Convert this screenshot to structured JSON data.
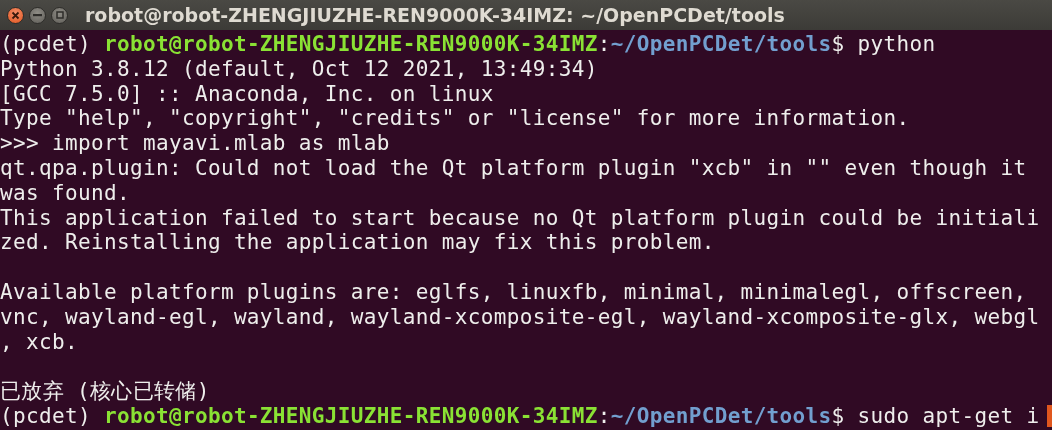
{
  "window": {
    "title": "robot@robot-ZHENGJIUZHE-REN9000K-34IMZ: ~/OpenPCDet/tools"
  },
  "terminal": {
    "lines": [
      {
        "kind": "prompt",
        "env": "(pcdet) ",
        "user_host": "robot@robot-ZHENGJIUZHE-REN9000K-34IMZ",
        "separator": ":",
        "path": "~/OpenPCDet/tools",
        "symbol": "$ ",
        "command": "python",
        "cursor": false
      },
      {
        "kind": "output",
        "text": "Python 3.8.12 (default, Oct 12 2021, 13:49:34)"
      },
      {
        "kind": "output",
        "text": "[GCC 7.5.0] :: Anaconda, Inc. on linux"
      },
      {
        "kind": "output",
        "text": "Type \"help\", \"copyright\", \"credits\" or \"license\" for more information."
      },
      {
        "kind": "output",
        "text": ">>> import mayavi.mlab as mlab"
      },
      {
        "kind": "output",
        "text": "qt.qpa.plugin: Could not load the Qt platform plugin \"xcb\" in \"\" even though it"
      },
      {
        "kind": "output",
        "text": "was found."
      },
      {
        "kind": "output",
        "text": "This application failed to start because no Qt platform plugin could be initiali"
      },
      {
        "kind": "output",
        "text": "zed. Reinstalling the application may fix this problem."
      },
      {
        "kind": "blank"
      },
      {
        "kind": "output",
        "text": "Available platform plugins are: eglfs, linuxfb, minimal, minimalegl, offscreen,"
      },
      {
        "kind": "output",
        "text": "vnc, wayland-egl, wayland, wayland-xcomposite-egl, wayland-xcomposite-glx, webgl"
      },
      {
        "kind": "output",
        "text": ", xcb."
      },
      {
        "kind": "blank"
      },
      {
        "kind": "output",
        "text": "已放弃 (核心已转储)"
      },
      {
        "kind": "prompt",
        "env": "(pcdet) ",
        "user_host": "robot@robot-ZHENGJIUZHE-REN9000K-34IMZ",
        "separator": ":",
        "path": "~/OpenPCDet/tools",
        "symbol": "$ ",
        "command": "sudo apt-get i",
        "cursor": true
      }
    ]
  }
}
